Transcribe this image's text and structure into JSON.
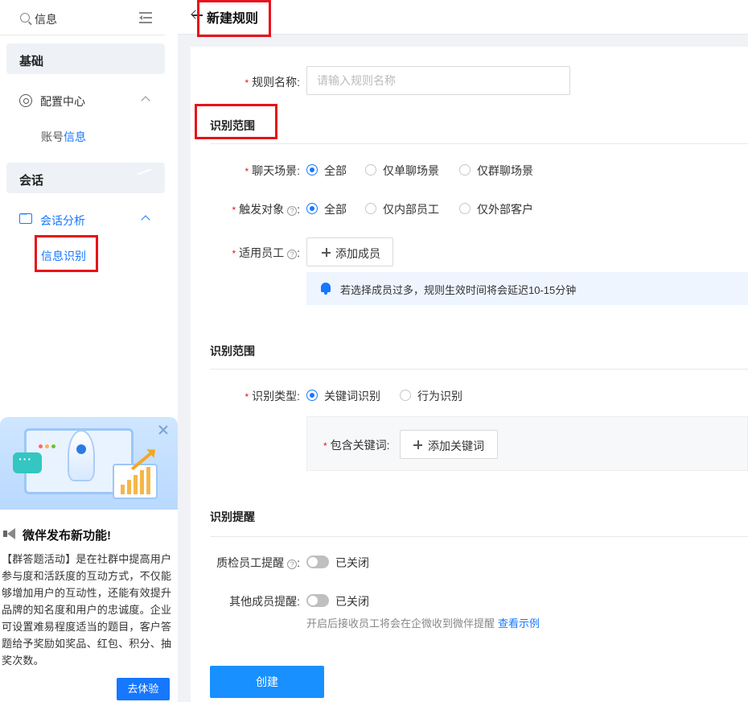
{
  "sidebar": {
    "search_value": "信息",
    "groups": [
      {
        "label": "基础"
      },
      {
        "label": "会话"
      }
    ],
    "config_center": {
      "label": "配置中心"
    },
    "account_info": {
      "prefix": "账号",
      "highlight": "信息"
    },
    "session_analysis": {
      "label": "会话分析"
    },
    "info_recognition": {
      "label": "信息识别"
    }
  },
  "promo": {
    "title": "微伴发布新功能!",
    "body": "【群答题活动】是在社群中提高用户参与度和活跃度的互动方式，不仅能够增加用户的互动性，还能有效提升品牌的知名度和用户的忠诚度。企业可设置难易程度适当的题目，客户答题给予奖励如奖品、红包、积分、抽奖次数。",
    "button": "去体验"
  },
  "header": {
    "title": "新建规则"
  },
  "form": {
    "rule_name": {
      "label": "规则名称:",
      "placeholder": "请输入规则名称",
      "value": ""
    },
    "section_scope_1": "识别范围",
    "chat_scene": {
      "label": "聊天场景:",
      "options": [
        "全部",
        "仅单聊场景",
        "仅群聊场景"
      ],
      "selected": 0
    },
    "trigger_target": {
      "label": "触发对象",
      "options": [
        "全部",
        "仅内部员工",
        "仅外部客户"
      ],
      "selected": 0
    },
    "applicable_staff": {
      "label": "适用员工",
      "button": "添加成员"
    },
    "notice": "若选择成员过多，规则生效时间将会延迟10-15分钟",
    "section_scope_2": "识别范围",
    "recognition_type": {
      "label": "识别类型:",
      "options": [
        "关键词识别",
        "行为识别"
      ],
      "selected": 0
    },
    "keywords": {
      "label": "包含关键词:",
      "button": "添加关键词"
    },
    "section_alert": "识别提醒",
    "qc_alert": {
      "label": "质检员工提醒",
      "state": "已关闭"
    },
    "other_alert": {
      "label": "其他成员提醒:",
      "state": "已关闭"
    },
    "hint": {
      "text": "开启后接收员工将会在企微收到微伴提醒",
      "link": "查看示例"
    },
    "submit": "创建"
  },
  "colors": {
    "accent": "#1677ff",
    "highlight_box": "#e8101a"
  }
}
